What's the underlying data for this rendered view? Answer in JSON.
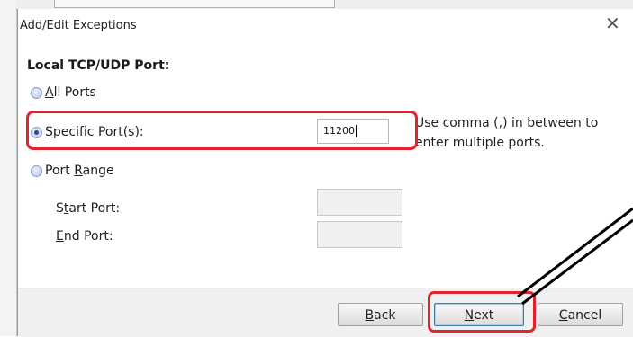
{
  "window": {
    "title": "Add/Edit Exceptions",
    "close_glyph": "✕"
  },
  "section": {
    "heading": "Local TCP/UDP Port:"
  },
  "radios": {
    "all_ports": {
      "mnemonic": "A",
      "rest": "ll Ports",
      "checked": false
    },
    "specific_ports": {
      "mnemonic": "S",
      "rest": "pecific Port(s):",
      "checked": true
    },
    "port_range": {
      "before": "Port ",
      "mnemonic": "R",
      "rest": "ange",
      "checked": false
    }
  },
  "specific_ports_input": {
    "value": "11200"
  },
  "hint": {
    "line1": "Use comma (,) in between to",
    "line2": "enter multiple ports."
  },
  "range_fields": {
    "start_label": {
      "before": "S",
      "mnemonic": "t",
      "rest": "art Port:"
    },
    "end_label": {
      "mnemonic": "E",
      "rest": "nd Port:"
    },
    "start_value": "",
    "end_value": ""
  },
  "buttons": {
    "back": {
      "mnemonic": "B",
      "rest": "ack"
    },
    "next": {
      "mnemonic": "N",
      "rest": "ext"
    },
    "cancel": {
      "mnemonic": "C",
      "rest": "ancel"
    }
  },
  "colors": {
    "highlight": "#e3222b",
    "annotation_arrow": "#000000",
    "footer_bg": "#f0f0f0"
  }
}
